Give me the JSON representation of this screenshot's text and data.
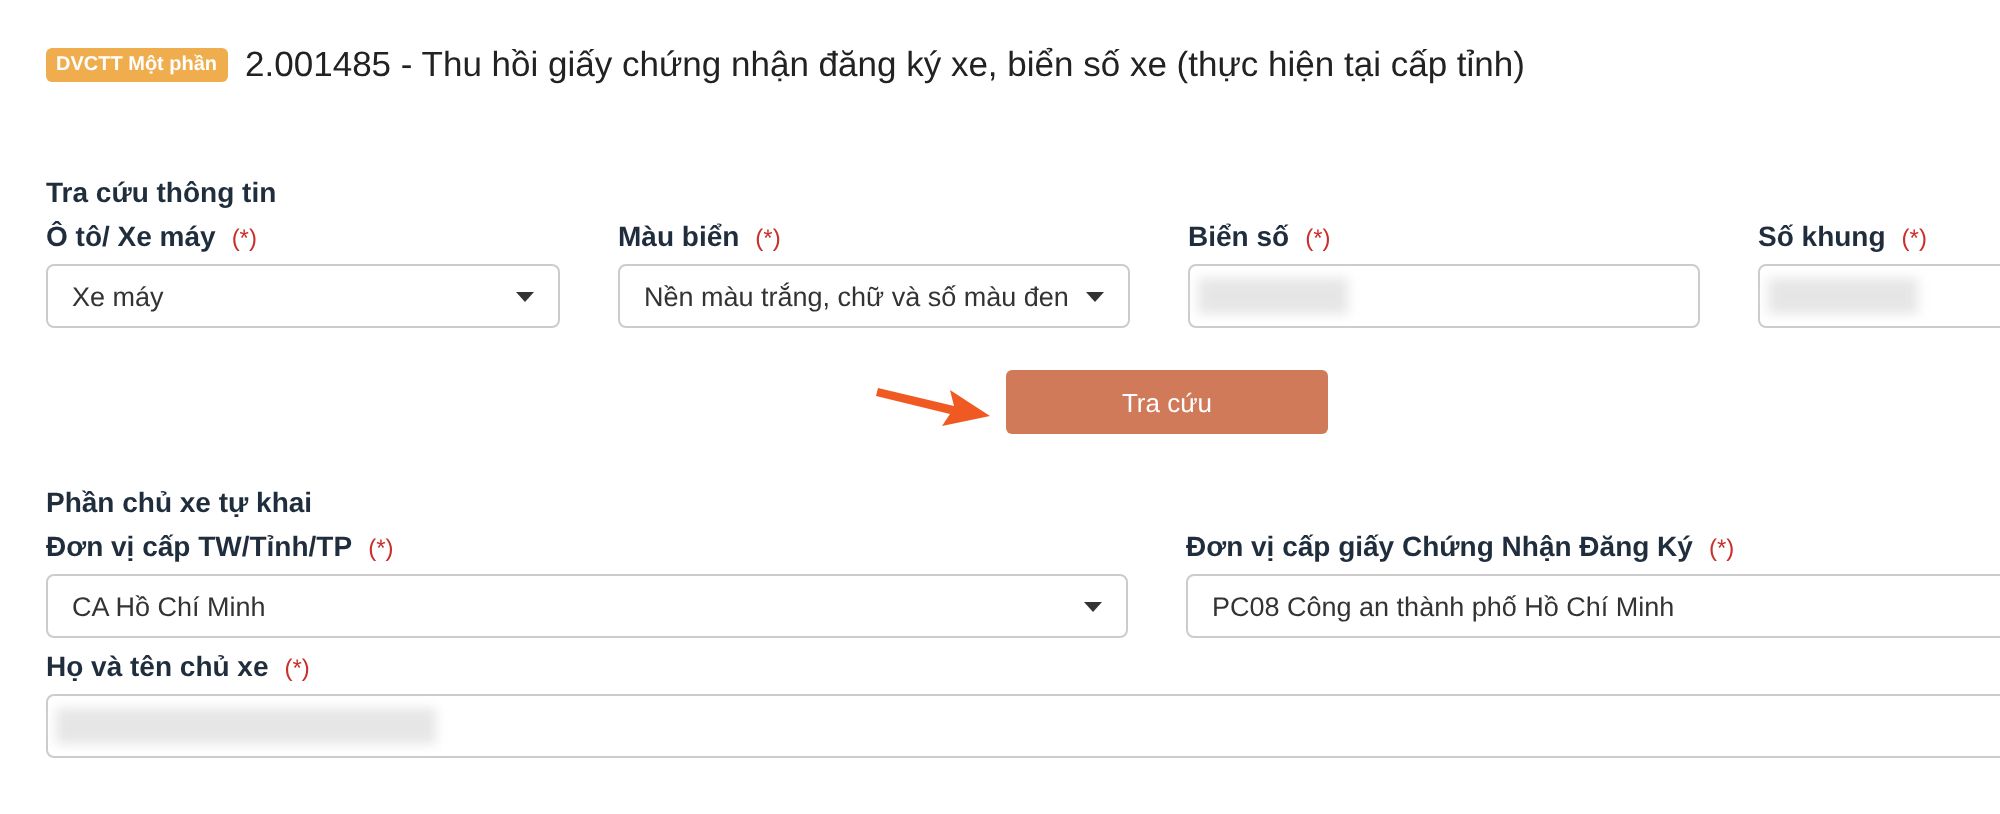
{
  "header": {
    "badge": "DVCTT Một phần",
    "title": "2.001485 - Thu hồi giấy chứng nhận đăng ký xe, biển số xe (thực hiện tại cấp tỉnh)"
  },
  "lookup": {
    "heading": "Tra cứu thông tin",
    "fields": [
      {
        "kind": "select",
        "label": "Ô tô/ Xe máy",
        "required_mark": "(*)",
        "value": "Xe máy"
      },
      {
        "kind": "select",
        "label": "Màu biển",
        "required_mark": "(*)",
        "value": "Nền màu trắng, chữ và số màu đen"
      },
      {
        "kind": "input",
        "label": "Biển số",
        "required_mark": "(*)",
        "redacted": true
      },
      {
        "kind": "input",
        "label": "Số khung",
        "required_mark": "(*)",
        "redacted": true
      }
    ],
    "button": "Tra cứu"
  },
  "owner": {
    "heading": "Phần chủ xe tự khai",
    "fields": [
      {
        "kind": "select",
        "label": "Đơn vị cấp TW/Tỉnh/TP",
        "required_mark": "(*)",
        "value": "CA Hồ Chí Minh"
      },
      {
        "kind": "input",
        "label": "Đơn vị cấp giấy Chứng Nhận Đăng Ký",
        "required_mark": "(*)",
        "value": "PC08 Công an thành phố Hồ Chí Minh"
      }
    ],
    "name_field": {
      "kind": "input",
      "label": "Họ và tên chủ xe",
      "required_mark": "(*)",
      "redacted": true
    }
  }
}
